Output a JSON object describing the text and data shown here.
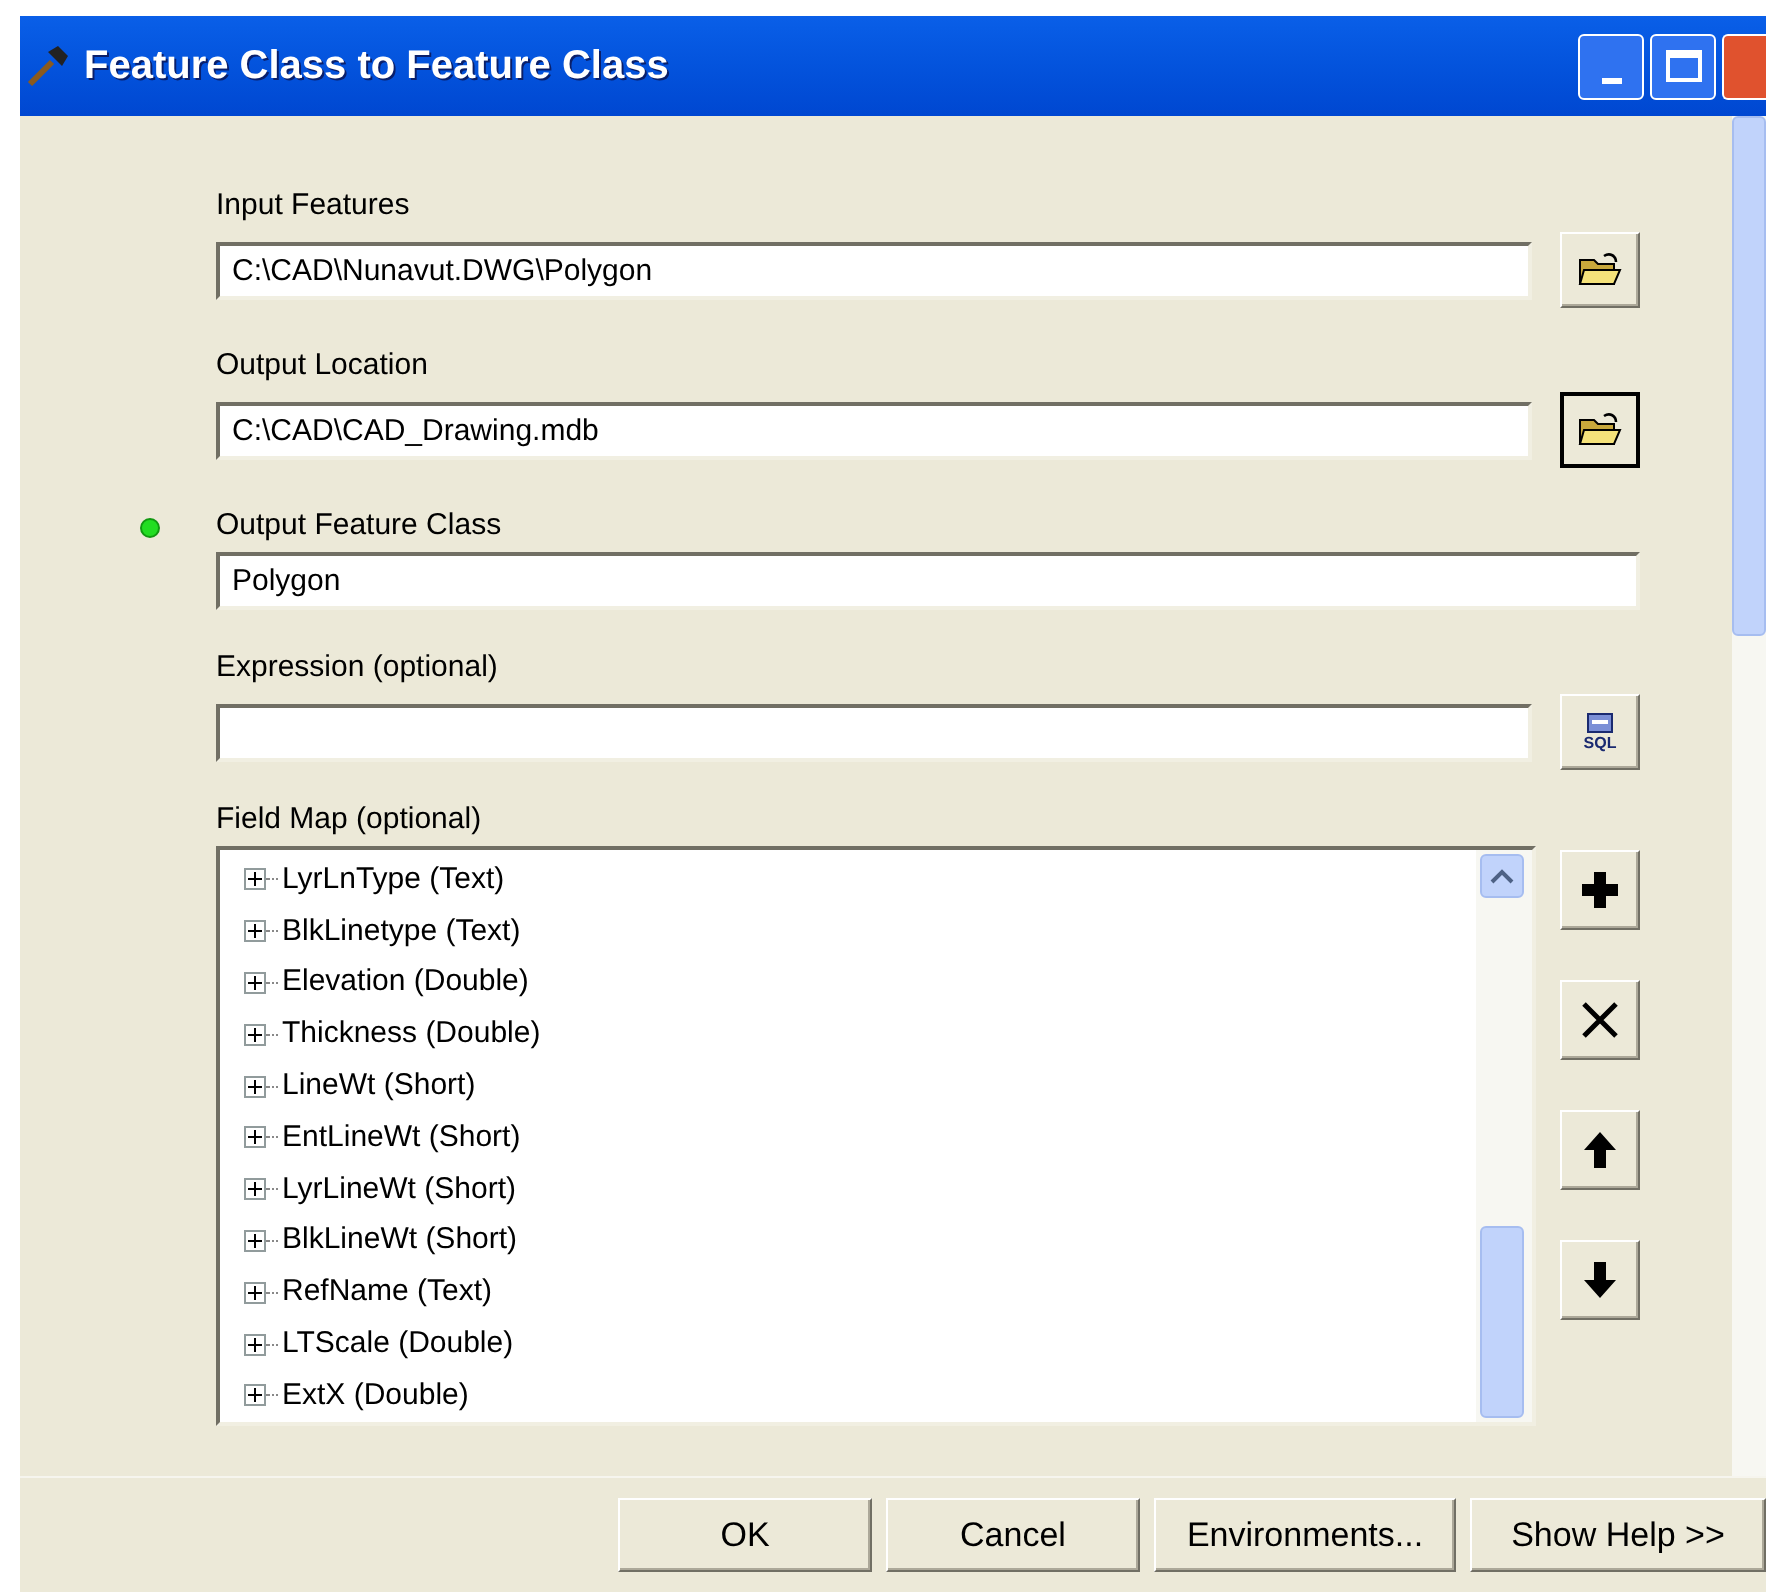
{
  "window": {
    "title": "Feature Class to Feature Class"
  },
  "fields": [
    {
      "label": "Input Features",
      "value": "C:\\CAD\\Nunavut.DWG\\Polygon",
      "flagged": false,
      "button": {
        "kind": "folder",
        "focused": false
      }
    },
    {
      "label": "Output Location",
      "value": "C:\\CAD\\CAD_Drawing.mdb",
      "flagged": false,
      "button": {
        "kind": "folder",
        "focused": true
      }
    },
    {
      "label": "Output Feature Class",
      "value": "Polygon",
      "flagged": true,
      "button": {
        "kind": "none"
      }
    },
    {
      "label": "Expression (optional)",
      "flagged": false,
      "button": {
        "kind": "sql",
        "focused": false,
        "label": "SQL"
      }
    }
  ],
  "field_map": {
    "label": "Field Map (optional)",
    "items": [
      {
        "name": "LyrLnType (Text)",
        "expanded": false
      },
      {
        "name": "BlkLinetype (Text)",
        "expanded": false
      },
      {
        "name": "Elevation (Double)",
        "expanded": false
      },
      {
        "name": "Thickness (Double)",
        "expanded": false
      },
      {
        "name": "LineWt (Short)",
        "expanded": false
      },
      {
        "name": "EntLineWt (Short)",
        "expanded": false
      },
      {
        "name": "LyrLineWt (Short)",
        "expanded": false
      },
      {
        "name": "BlkLineWt (Short)",
        "expanded": false
      },
      {
        "name": "RefName (Text)",
        "expanded": false
      },
      {
        "name": "LTScale (Double)",
        "expanded": false
      },
      {
        "name": "ExtX (Double)",
        "expanded": false
      }
    ],
    "tools": [
      {
        "kind": "add"
      },
      {
        "kind": "remove"
      },
      {
        "kind": "up"
      },
      {
        "kind": "down"
      }
    ]
  },
  "buttons": [
    "OK",
    "Cancel",
    "Environments...",
    "Show Help >>"
  ]
}
